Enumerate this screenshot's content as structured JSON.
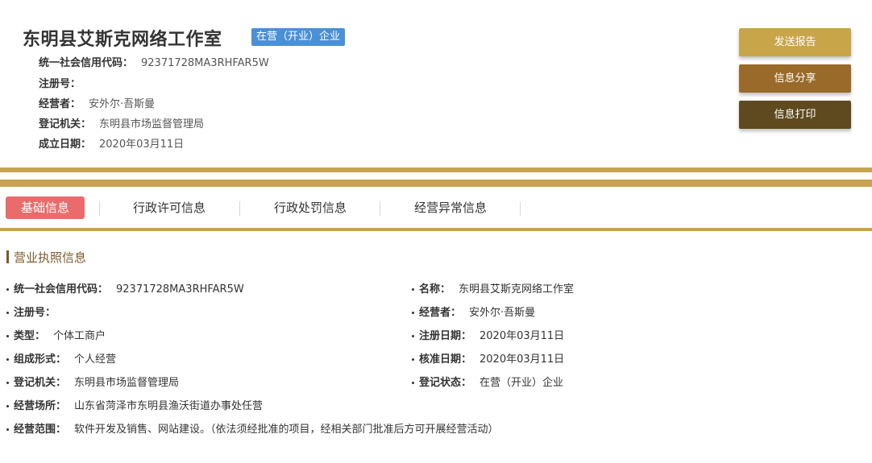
{
  "company": {
    "name": "东明县艾斯克网络工作室",
    "status_badge": "在营（开业）企业"
  },
  "meta": [
    {
      "label": "统一社会信用代码：",
      "value": "92371728MA3RHFAR5W"
    },
    {
      "label": "注册号：",
      "value": ""
    },
    {
      "label": "经营者：",
      "value": "安外尔·吾斯曼"
    },
    {
      "label": "登记机关：",
      "value": "东明县市场监督管理局"
    },
    {
      "label": "成立日期：",
      "value": "2020年03月11日"
    }
  ],
  "actions": {
    "send_report": "发送报告",
    "share": "信息分享",
    "print": "信息打印"
  },
  "tabs": [
    "基础信息",
    "行政许可信息",
    "行政处罚信息",
    "经营异常信息"
  ],
  "section": {
    "title": "营业执照信息",
    "left": [
      {
        "label": "统一社会信用代码：",
        "value": "92371728MA3RHFAR5W"
      },
      {
        "label": "注册号：",
        "value": ""
      },
      {
        "label": "类型：",
        "value": "个体工商户"
      },
      {
        "label": "组成形式：",
        "value": "个人经营"
      },
      {
        "label": "登记机关：",
        "value": "东明县市场监督管理局"
      },
      {
        "label": "经营场所：",
        "value": "山东省菏泽市东明县渔沃街道办事处任营"
      },
      {
        "label": "经营范围：",
        "value": "软件开发及销售、网站建设。（依法须经批准的项目，经相关部门批准后方可开展经营活动）"
      }
    ],
    "right": [
      {
        "label": "名称：",
        "value": "东明县艾斯克网络工作室"
      },
      {
        "label": "经营者：",
        "value": "安外尔·吾斯曼"
      },
      {
        "label": "注册日期：",
        "value": "2020年03月11日"
      },
      {
        "label": "核准日期：",
        "value": "2020年03月11日"
      },
      {
        "label": "登记状态：",
        "value": "在营（开业）企业"
      }
    ]
  },
  "colors": {
    "gold": "#c8a451",
    "active_tab": "#ea6b6b",
    "badge": "#4a90d6",
    "section_title": "#7a5a2a"
  }
}
